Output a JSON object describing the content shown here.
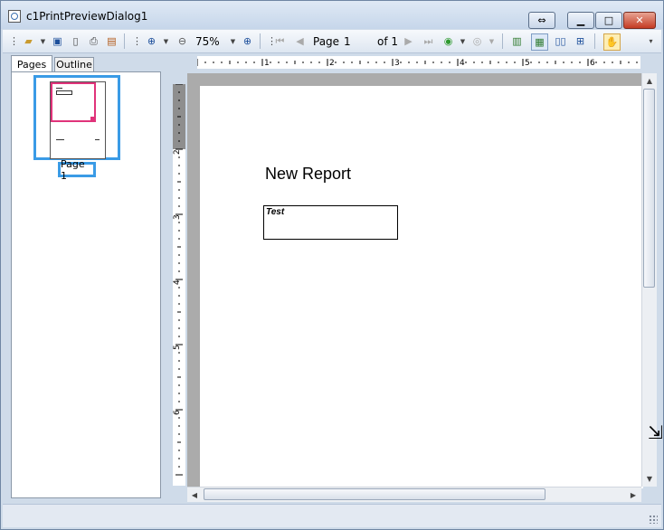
{
  "window": {
    "title": "c1PrintPreviewDialog1"
  },
  "toolbar": {
    "zoom_value": "75%",
    "page_label": "Page",
    "page_value": "1",
    "of_label": "of 1"
  },
  "left_panel": {
    "tabs": [
      {
        "label": "Pages"
      },
      {
        "label": "Outline"
      }
    ],
    "thumbnail_label": "Page 1"
  },
  "ruler": {
    "horizontal_ticks": [
      "1",
      "2",
      "3",
      "4",
      "5",
      "6"
    ],
    "vertical_ticks": [
      "2",
      "3",
      "4",
      "5",
      "6"
    ]
  },
  "report": {
    "title": "New Report",
    "field_text": "Test"
  },
  "colors": {
    "thumbnail_selection": "#3a9be6",
    "magnifier_frame": "#e0337a",
    "preview_background": "#ababab"
  }
}
